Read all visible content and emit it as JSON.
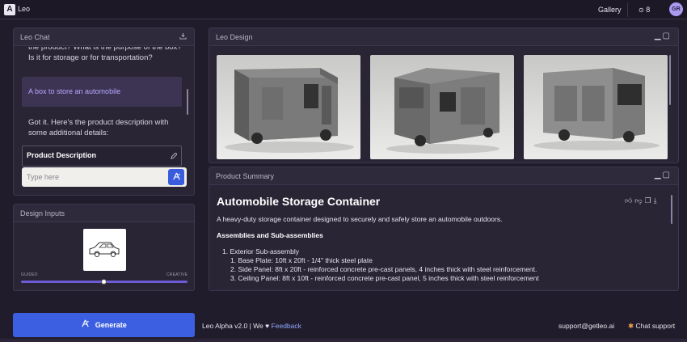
{
  "topbar": {
    "logo_text": "Leo",
    "logo_mark": "A",
    "gallery": "Gallery",
    "credits": "8",
    "credits_icon": "coin-icon",
    "avatar": "GR"
  },
  "chat": {
    "title": "Leo Chat",
    "question_partial": "the product? What is the purpose of the box? Is it for storage or for transportation?",
    "user_reply": "A box to store an automobile",
    "bot_reply": "Got it. Here's the product description with some additional details:",
    "desc_title": "Product Description",
    "input_placeholder": "Type here"
  },
  "design_inputs": {
    "title": "Design Inputs",
    "guided": "GUIDED",
    "creative": "CREATIVE",
    "slider_value": 0.5
  },
  "design": {
    "title": "Leo Design",
    "images": [
      "truck-render-front-left",
      "truck-render-rear",
      "truck-render-front-right"
    ]
  },
  "summary": {
    "title": "Product Summary",
    "heading": "Automobile Storage Container",
    "description": "A heavy-duty storage container designed to securely and safely store an automobile outdoors.",
    "section": "Assemblies and Sub-assemblies",
    "item1": "1. Exterior Sub-assembly",
    "subitems": [
      "1. Base Plate: 10ft x 20ft - 1/4\" thick steel plate",
      "2. Side Panel: 8ft x 20ft - reinforced concrete pre-cast panels, 4 inches thick with steel reinforcement.",
      "3. Ceiling Panel: 8ft x 10ft - reinforced concrete pre-cast panel, 5 inches thick with steel reinforcement"
    ]
  },
  "footer": {
    "generate": "Generate",
    "version": "Leo Alpha v2.0 | We ",
    "feedback": "Feedback",
    "support_email": "support@getleo.ai",
    "chat_support": "Chat support"
  },
  "colors": {
    "accent": "#3b5fe0",
    "background": "#211c2b",
    "panel": "#2a2535",
    "user_bubble_text": "#b5a9ff"
  }
}
